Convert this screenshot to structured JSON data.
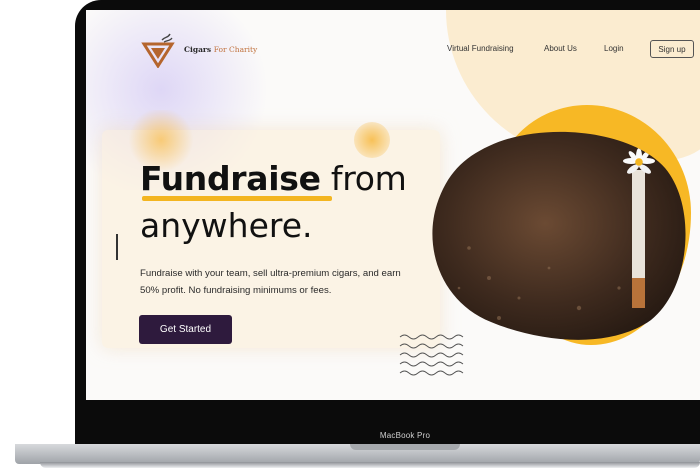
{
  "brand": {
    "name_part1": "Cigars",
    "name_part2": "For Charity"
  },
  "nav": {
    "items": [
      {
        "label": "Virtual Fundraising"
      },
      {
        "label": "About Us"
      },
      {
        "label": "Login"
      }
    ],
    "signup_label": "Sign up"
  },
  "hero": {
    "headline_highlight": "Fundraise",
    "headline_rest": " from",
    "headline_line2": "anywhere.",
    "subtext": "Fundraise with your team, sell ultra-premium cigars, and earn 50% profit. No fundraising minimums or fees.",
    "cta_label": "Get Started"
  },
  "device": {
    "model_label": "MacBook Pro"
  },
  "colors": {
    "accent_yellow": "#f7b825",
    "cta_bg": "#2e1a3d",
    "cream": "#fbecd0",
    "brand_copper": "#c0703a"
  },
  "icons": {
    "logo": "logo-icon",
    "decor": "wave-lines-icon"
  }
}
